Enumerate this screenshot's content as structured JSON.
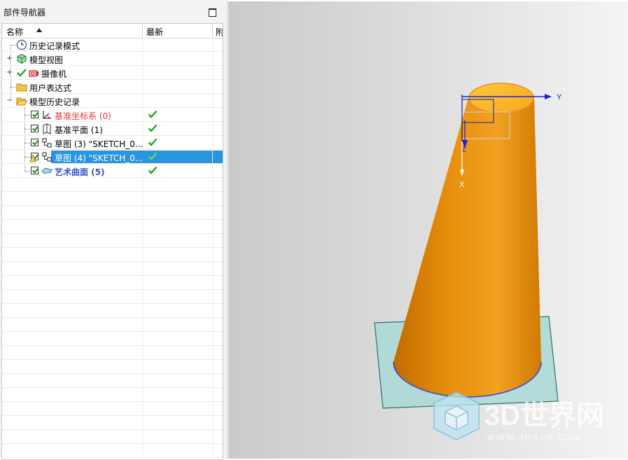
{
  "navigator": {
    "title": "部件导航器",
    "columns": {
      "name": "名称",
      "latest": "最新",
      "third": "附"
    },
    "items": [
      {
        "label": "历史记录模式"
      },
      {
        "label": "模型视图"
      },
      {
        "label": "摄像机"
      },
      {
        "label": "用户表达式"
      },
      {
        "label": "模型历史记录"
      },
      {
        "label": "基准坐标系 (0)",
        "latest": true
      },
      {
        "label": "基准平面 (1)",
        "latest": true
      },
      {
        "label": "草图 (3) \"SKETCH_0...",
        "latest": true
      },
      {
        "label": "草图 (4) \"SKETCH_0...",
        "latest": true,
        "selected": true
      },
      {
        "label": "艺术曲面 (5)",
        "latest": true
      }
    ]
  },
  "viewport": {
    "axes": {
      "y": "Y",
      "z": "Z",
      "x": "X"
    },
    "watermark": {
      "main": "3D世界网",
      "sub": "WWW.3DSJW.COM"
    }
  },
  "colors": {
    "selection": "#2a94dd",
    "solid": "#e8900c",
    "plane": "#a8d8d6",
    "checkmark": "#1fa81f"
  }
}
